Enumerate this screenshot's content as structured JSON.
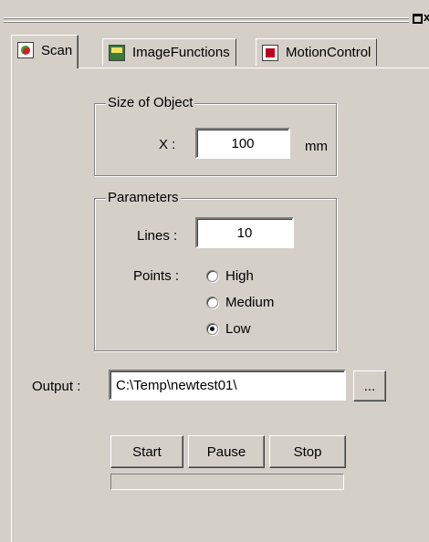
{
  "window": {
    "restore_icon": "restore-icon",
    "close_icon": "close-icon",
    "close_glyph": "x"
  },
  "tabs": [
    {
      "label": "Scan",
      "icon": "scan-icon",
      "active": true
    },
    {
      "label": "ImageFunctions",
      "icon": "image-functions-icon",
      "active": false
    },
    {
      "label": "MotionControl",
      "icon": "motion-control-icon",
      "active": false
    }
  ],
  "size_of_object": {
    "legend": "Size of Object",
    "x_label": "X :",
    "x_value": "100",
    "unit": "mm"
  },
  "parameters": {
    "legend": "Parameters",
    "lines_label": "Lines :",
    "lines_value": "10",
    "points_label": "Points :",
    "points_options": [
      "High",
      "Medium",
      "Low"
    ],
    "points_selected": "Low"
  },
  "output": {
    "label": "Output :",
    "value": "C:\\Temp\\newtest01\\",
    "browse_label": "..."
  },
  "actions": {
    "start_label": "Start",
    "pause_label": "Pause",
    "stop_label": "Stop"
  },
  "progress": {
    "value": 0
  }
}
